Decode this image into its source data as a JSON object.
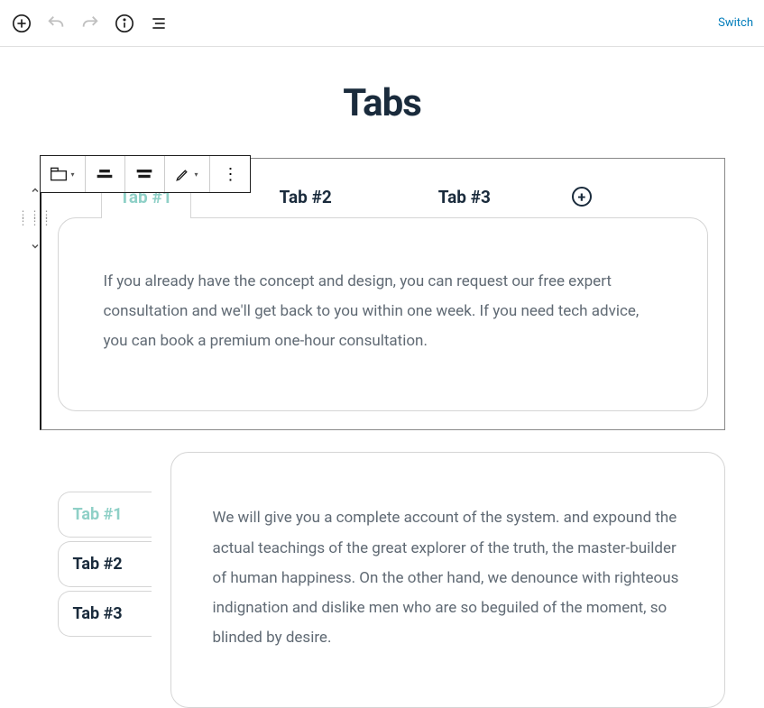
{
  "header": {
    "switch_label": "Switch"
  },
  "page": {
    "title": "Tabs"
  },
  "block1": {
    "tabs": [
      {
        "label": "Tab #1",
        "active": true
      },
      {
        "label": "Tab #2",
        "active": false
      },
      {
        "label": "Tab #3",
        "active": false
      }
    ],
    "content": "If you already have the concept and design, you can request our free expert consultation and we'll get back to you within one week. If you need tech advice, you can book a premium one-hour consultation."
  },
  "block2": {
    "tabs": [
      {
        "label": "Tab #1",
        "active": true
      },
      {
        "label": "Tab #2",
        "active": false
      },
      {
        "label": "Tab #3",
        "active": false
      }
    ],
    "content": "We will give you a complete account of the system. and expound the actual teachings of the great explorer of the truth, the master-builder of human happiness. On the other hand, we denounce with righteous indignation and dislike men who are so beguiled of the moment, so blinded by desire."
  }
}
